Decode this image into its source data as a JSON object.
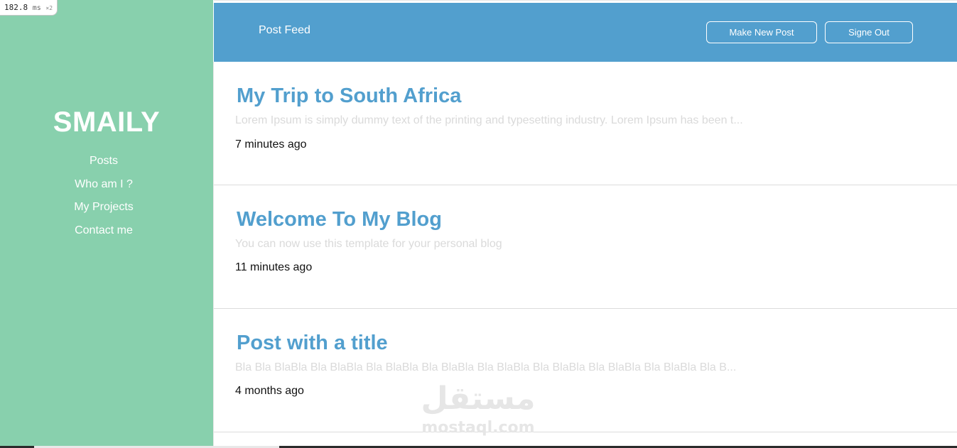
{
  "perf": {
    "value": "182.8",
    "unit": "ms",
    "multiplier": "×2"
  },
  "sidebar": {
    "brand": "SMAILY",
    "items": [
      {
        "label": "Posts"
      },
      {
        "label": "Who am I ?"
      },
      {
        "label": "My Projects"
      },
      {
        "label": "Contact me"
      }
    ]
  },
  "header": {
    "title": "Post Feed",
    "make_post_label": "Make New Post",
    "sign_out_label": "Signe Out"
  },
  "posts": [
    {
      "title": "My Trip to South Africa",
      "excerpt": "Lorem Ipsum is simply dummy text of the printing and typesetting industry. Lorem Ipsum has been t...",
      "time": "7 minutes ago"
    },
    {
      "title": "Welcome To My Blog",
      "excerpt": "You can now use this template for your personal blog",
      "time": "11 minutes ago"
    },
    {
      "title": "Post with a title",
      "excerpt": "Bla Bla BlaBla Bla BlaBla Bla BlaBla Bla BlaBla Bla BlaBla Bla BlaBla Bla BlaBla Bla BlaBla Bla B...",
      "time": "4 months ago"
    }
  ],
  "watermark": {
    "arabic": "مستقل",
    "latin": "mostaql.com"
  },
  "colors": {
    "sidebar_bg": "#88d0ad",
    "header_bg": "#529fce",
    "title_color": "#529fce",
    "excerpt_color": "#dadada"
  }
}
